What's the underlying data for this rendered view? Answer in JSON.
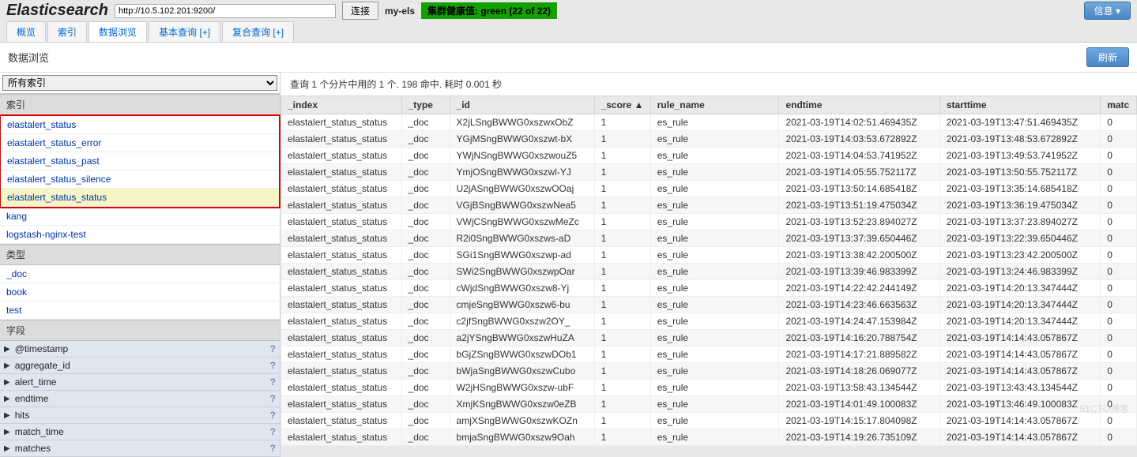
{
  "header": {
    "logo": "Elasticsearch",
    "url": "http://10.5.102.201:9200/",
    "connect_btn": "连接",
    "cluster_name": "my-els",
    "health_label": "集群健康值: green (22 of 22)",
    "info_btn": "信息"
  },
  "tabs": [
    {
      "label": "概览"
    },
    {
      "label": "索引"
    },
    {
      "label": "数据浏览"
    },
    {
      "label": "基本查询 [+]"
    },
    {
      "label": "复合查询 [+]"
    }
  ],
  "active_tab": 2,
  "subhead": {
    "title": "数据浏览",
    "refresh": "刷新"
  },
  "sidebar": {
    "select_value": "所有索引",
    "section_index": "索引",
    "indices": [
      "elastalert_status",
      "elastalert_status_error",
      "elastalert_status_past",
      "elastalert_status_silence",
      "elastalert_status_status",
      "kang",
      "logstash-nginx-test"
    ],
    "selected_index": 4,
    "section_type": "类型",
    "types": [
      "_doc",
      "book",
      "test"
    ],
    "section_field": "字段",
    "fields": [
      "@timestamp",
      "aggregate_id",
      "alert_time",
      "endtime",
      "hits",
      "match_time",
      "matches"
    ]
  },
  "query_info": "查询 1 个分片中用的 1 个. 198 命中. 耗时 0.001 秒",
  "columns": [
    "_index",
    "_type",
    "_id",
    "_score ▲",
    "rule_name",
    "endtime",
    "starttime",
    "matc"
  ],
  "rows": [
    {
      "index": "elastalert_status_status",
      "type": "_doc",
      "id": "X2jLSngBWWG0xszwxObZ",
      "score": "1",
      "rule": "es_rule",
      "end": "2021-03-19T14:02:51.469435Z",
      "start": "2021-03-19T13:47:51.469435Z",
      "m": "0"
    },
    {
      "index": "elastalert_status_status",
      "type": "_doc",
      "id": "YGjMSngBWWG0xszwt-bX",
      "score": "1",
      "rule": "es_rule",
      "end": "2021-03-19T14:03:53.672892Z",
      "start": "2021-03-19T13:48:53.672892Z",
      "m": "0"
    },
    {
      "index": "elastalert_status_status",
      "type": "_doc",
      "id": "YWjNSngBWWG0xszwouZ5",
      "score": "1",
      "rule": "es_rule",
      "end": "2021-03-19T14:04:53.741952Z",
      "start": "2021-03-19T13:49:53.741952Z",
      "m": "0"
    },
    {
      "index": "elastalert_status_status",
      "type": "_doc",
      "id": "YmjOSngBWWG0xszwl-YJ",
      "score": "1",
      "rule": "es_rule",
      "end": "2021-03-19T14:05:55.752117Z",
      "start": "2021-03-19T13:50:55.752117Z",
      "m": "0"
    },
    {
      "index": "elastalert_status_status",
      "type": "_doc",
      "id": "U2jASngBWWG0xszwOOaj",
      "score": "1",
      "rule": "es_rule",
      "end": "2021-03-19T13:50:14.685418Z",
      "start": "2021-03-19T13:35:14.685418Z",
      "m": "0"
    },
    {
      "index": "elastalert_status_status",
      "type": "_doc",
      "id": "VGjBSngBWWG0xszwNea5",
      "score": "1",
      "rule": "es_rule",
      "end": "2021-03-19T13:51:19.475034Z",
      "start": "2021-03-19T13:36:19.475034Z",
      "m": "0"
    },
    {
      "index": "elastalert_status_status",
      "type": "_doc",
      "id": "VWjCSngBWWG0xszwMeZc",
      "score": "1",
      "rule": "es_rule",
      "end": "2021-03-19T13:52:23.894027Z",
      "start": "2021-03-19T13:37:23.894027Z",
      "m": "0"
    },
    {
      "index": "elastalert_status_status",
      "type": "_doc",
      "id": "R2i0SngBWWG0xszws-aD",
      "score": "1",
      "rule": "es_rule",
      "end": "2021-03-19T13:37:39.650446Z",
      "start": "2021-03-19T13:22:39.650446Z",
      "m": "0"
    },
    {
      "index": "elastalert_status_status",
      "type": "_doc",
      "id": "SGi1SngBWWG0xszwp-ad",
      "score": "1",
      "rule": "es_rule",
      "end": "2021-03-19T13:38:42.200500Z",
      "start": "2021-03-19T13:23:42.200500Z",
      "m": "0"
    },
    {
      "index": "elastalert_status_status",
      "type": "_doc",
      "id": "SWi2SngBWWG0xszwpOar",
      "score": "1",
      "rule": "es_rule",
      "end": "2021-03-19T13:39:46.983399Z",
      "start": "2021-03-19T13:24:46.983399Z",
      "m": "0"
    },
    {
      "index": "elastalert_status_status",
      "type": "_doc",
      "id": "cWjdSngBWWG0xszw8-Yj",
      "score": "1",
      "rule": "es_rule",
      "end": "2021-03-19T14:22:42.244149Z",
      "start": "2021-03-19T14:20:13.347444Z",
      "m": "0"
    },
    {
      "index": "elastalert_status_status",
      "type": "_doc",
      "id": "cmjeSngBWWG0xszw6-bu",
      "score": "1",
      "rule": "es_rule",
      "end": "2021-03-19T14:23:46.663563Z",
      "start": "2021-03-19T14:20:13.347444Z",
      "m": "0"
    },
    {
      "index": "elastalert_status_status",
      "type": "_doc",
      "id": "c2jfSngBWWG0xszw2OY_",
      "score": "1",
      "rule": "es_rule",
      "end": "2021-03-19T14:24:47.153984Z",
      "start": "2021-03-19T14:20:13.347444Z",
      "m": "0"
    },
    {
      "index": "elastalert_status_status",
      "type": "_doc",
      "id": "a2jYSngBWWG0xszwHuZA",
      "score": "1",
      "rule": "es_rule",
      "end": "2021-03-19T14:16:20.788754Z",
      "start": "2021-03-19T14:14:43.057867Z",
      "m": "0"
    },
    {
      "index": "elastalert_status_status",
      "type": "_doc",
      "id": "bGjZSngBWWG0xszwDOb1",
      "score": "1",
      "rule": "es_rule",
      "end": "2021-03-19T14:17:21.889582Z",
      "start": "2021-03-19T14:14:43.057867Z",
      "m": "0"
    },
    {
      "index": "elastalert_status_status",
      "type": "_doc",
      "id": "bWjaSngBWWG0xszwCubo",
      "score": "1",
      "rule": "es_rule",
      "end": "2021-03-19T14:18:26.069077Z",
      "start": "2021-03-19T14:14:43.057867Z",
      "m": "0"
    },
    {
      "index": "elastalert_status_status",
      "type": "_doc",
      "id": "W2jHSngBWWG0xszw-ubF",
      "score": "1",
      "rule": "es_rule",
      "end": "2021-03-19T13:58:43.134544Z",
      "start": "2021-03-19T13:43:43.134544Z",
      "m": "0"
    },
    {
      "index": "elastalert_status_status",
      "type": "_doc",
      "id": "XmjKSngBWWG0xszw0eZB",
      "score": "1",
      "rule": "es_rule",
      "end": "2021-03-19T14:01:49.100083Z",
      "start": "2021-03-19T13:46:49.100083Z",
      "m": "0"
    },
    {
      "index": "elastalert_status_status",
      "type": "_doc",
      "id": "amjXSngBWWG0xszwKOZn",
      "score": "1",
      "rule": "es_rule",
      "end": "2021-03-19T14:15:17.804098Z",
      "start": "2021-03-19T14:14:43.057867Z",
      "m": "0"
    },
    {
      "index": "elastalert_status_status",
      "type": "_doc",
      "id": "bmjaSngBWWG0xszw9Oah",
      "score": "1",
      "rule": "es_rule",
      "end": "2021-03-19T14:19:26.735109Z",
      "start": "2021-03-19T14:14:43.057867Z",
      "m": "0"
    }
  ],
  "watermark": "51CTO博客"
}
